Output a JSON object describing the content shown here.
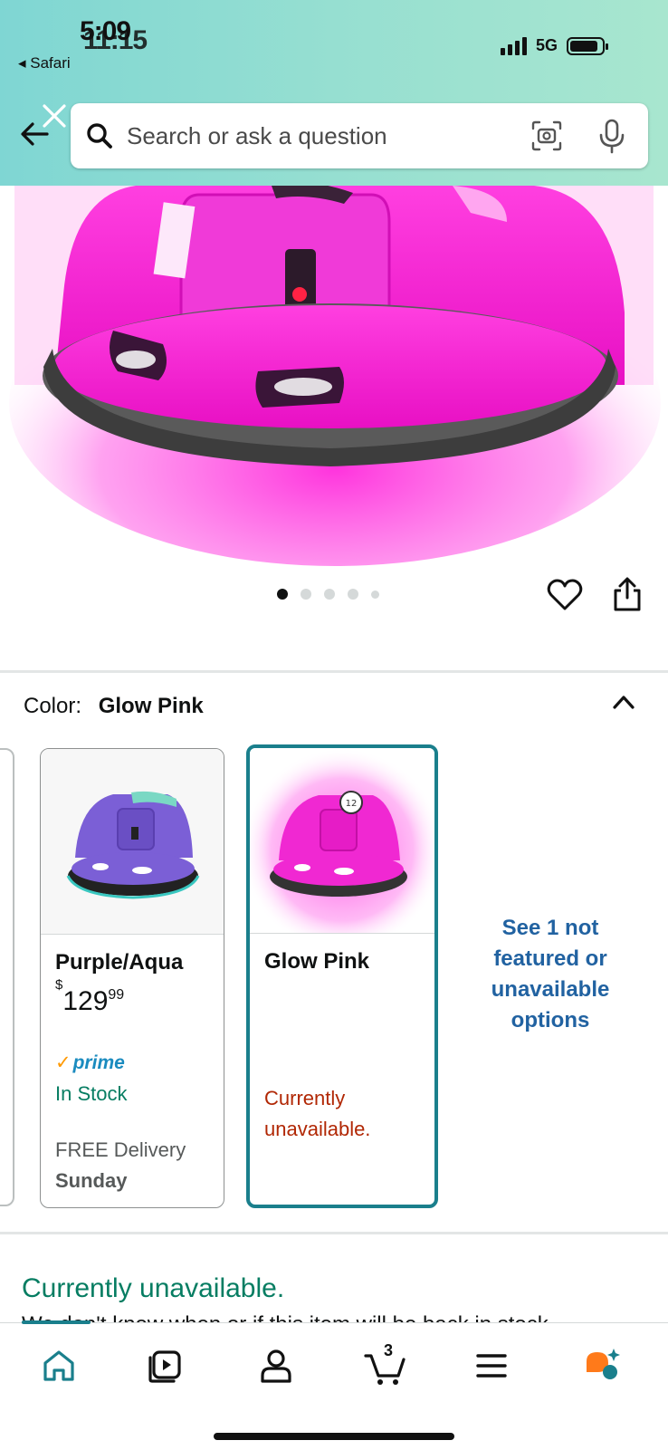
{
  "status_bar": {
    "time": "5:09",
    "time_overlap": "11:15",
    "back_app": "◂ Safari",
    "network": "5G"
  },
  "search": {
    "placeholder": "Search or ask a question"
  },
  "gallery": {
    "page_count": 5,
    "active_index": 0
  },
  "color_selector": {
    "label": "Color:",
    "selected": "Glow Pink",
    "options": [
      {
        "name": "Purple/Aqua",
        "price_symbol": "$",
        "price_whole": "129",
        "price_cents": "99",
        "prime": "prime",
        "stock": "In Stock",
        "delivery": "FREE Delivery",
        "delivery_day": "Sunday"
      },
      {
        "name": "Glow Pink",
        "availability": "Currently unavailable."
      }
    ],
    "see_more": "See 1 not featured or unavailable options"
  },
  "availability": {
    "headline": "Currently unavailable.",
    "detail": "We don't know when or if this item will be back in stock."
  },
  "bottom_nav": {
    "cart_count": "3",
    "items": [
      "home-icon",
      "video-icon",
      "account-icon",
      "cart-icon",
      "menu-icon",
      "assistant-icon"
    ]
  },
  "colors": {
    "accent_teal": "#1a7f8c",
    "in_stock_green": "#067d62",
    "unavailable_red": "#b12704",
    "link_blue": "#2162a1",
    "prime_blue": "#1a8bbf",
    "glow_pink": "#f21fd0"
  }
}
